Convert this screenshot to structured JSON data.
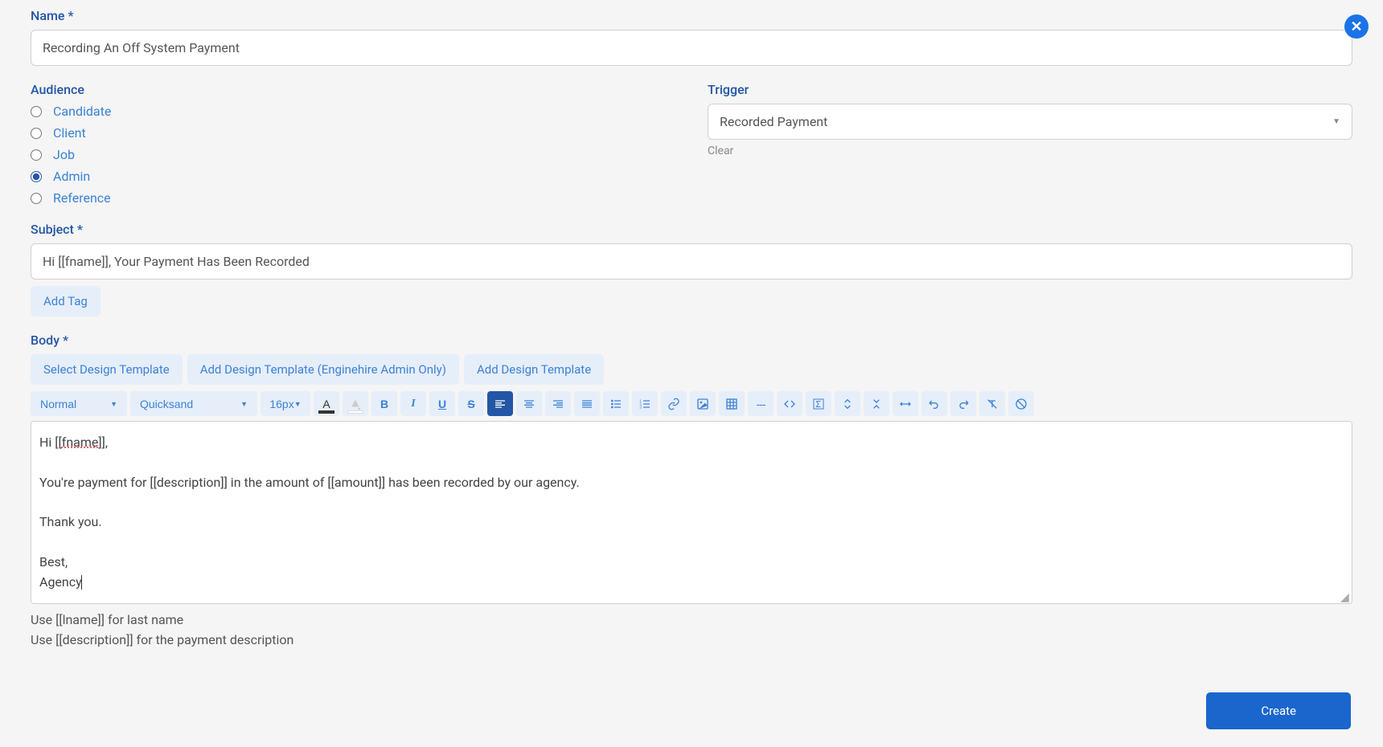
{
  "close_label": "×",
  "name": {
    "label": "Name *",
    "value": "Recording An Off System Payment"
  },
  "audience": {
    "label": "Audience",
    "options": [
      {
        "id": "candidate",
        "label": "Candidate",
        "checked": false
      },
      {
        "id": "client",
        "label": "Client",
        "checked": false
      },
      {
        "id": "job",
        "label": "Job",
        "checked": false
      },
      {
        "id": "admin",
        "label": "Admin",
        "checked": true
      },
      {
        "id": "reference",
        "label": "Reference",
        "checked": false
      }
    ]
  },
  "trigger": {
    "label": "Trigger",
    "value": "Recorded Payment",
    "clear_label": "Clear"
  },
  "subject": {
    "label": "Subject *",
    "value": "Hi [[fname]], Your Payment Has Been Recorded",
    "add_tag_label": "Add Tag"
  },
  "body": {
    "label": "Body *",
    "buttons": {
      "select_template": "Select Design Template",
      "add_template_admin": "Add Design Template (Enginehire Admin Only)",
      "add_template": "Add Design Template"
    },
    "toolbar": {
      "paragraph": "Normal",
      "font": "Quicksand",
      "size": "16px"
    },
    "content": {
      "line1_pre": "Hi [[",
      "line1_fname": "fname",
      "line1_post": "]],",
      "line2": "You're payment for [[description]] in the amount of [[amount]] has been recorded by our agency.",
      "line3": "Thank you.",
      "line4": "Best,",
      "line5": "Agency"
    }
  },
  "hints": {
    "line1": "Use [[lname]] for last name",
    "line2": "Use [[description]] for the payment description"
  },
  "create_label": "Create"
}
